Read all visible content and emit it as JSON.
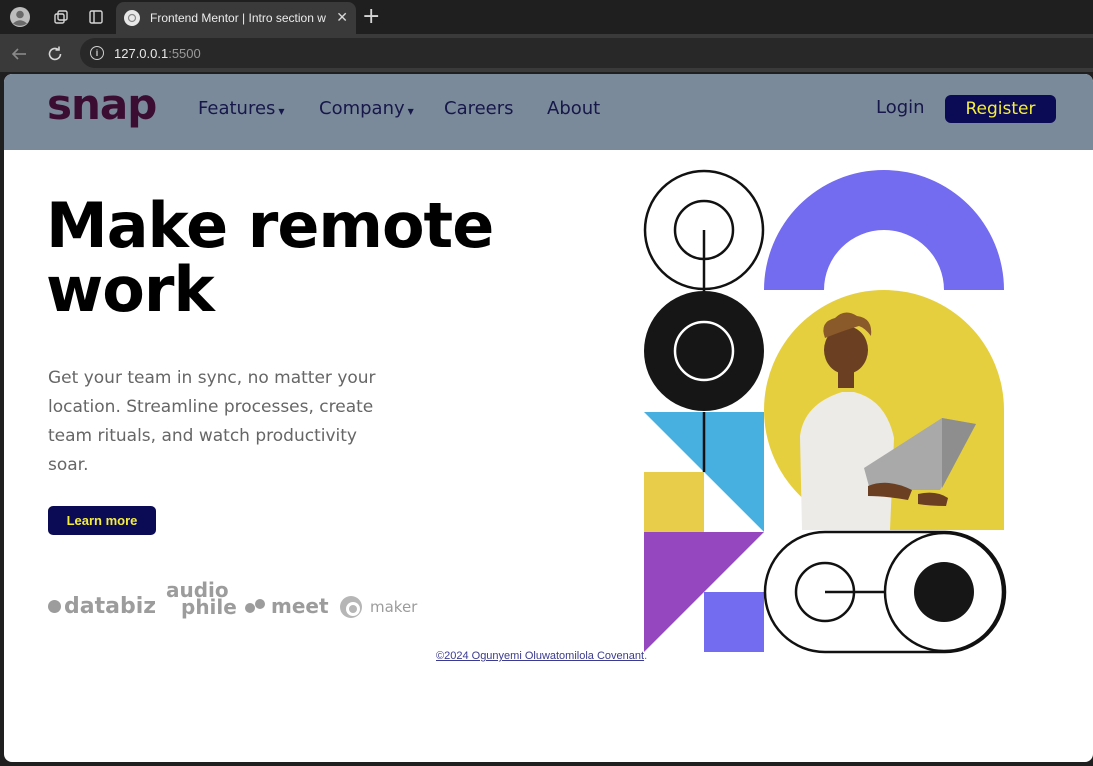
{
  "browser": {
    "tab_title": "Frontend Mentor | Intro section w",
    "url_host": "127.0.0.1",
    "url_port": ":5500"
  },
  "header": {
    "logo": "snap",
    "nav": [
      {
        "label": "Features",
        "dropdown": true
      },
      {
        "label": "Company",
        "dropdown": true
      },
      {
        "label": "Careers",
        "dropdown": false
      },
      {
        "label": "About",
        "dropdown": false
      }
    ],
    "login": "Login",
    "register": "Register"
  },
  "hero": {
    "title_line1": "Make remote",
    "title_line2": "work",
    "text": "Get your team in sync, no matter your location. Streamline processes, create team rituals, and watch productivity soar.",
    "cta": "Learn more"
  },
  "clients": {
    "databiz": "databiz",
    "audiophile_1": "audio",
    "audiophile_2": "phile",
    "meet": "meet",
    "maker": "maker"
  },
  "footer": {
    "credit_link": "©2024 Ogunyemi Oluwatomilola Covenant",
    "credit_suffix": "."
  },
  "colors": {
    "header_bg": "#7b8a9a",
    "brand_dark": "#0a0a55",
    "accent_yellow": "#f5ef3a",
    "purple": "#736bf0",
    "blue": "#47b0e0",
    "yellow": "#e8cd4a",
    "violet": "#9547c0"
  }
}
